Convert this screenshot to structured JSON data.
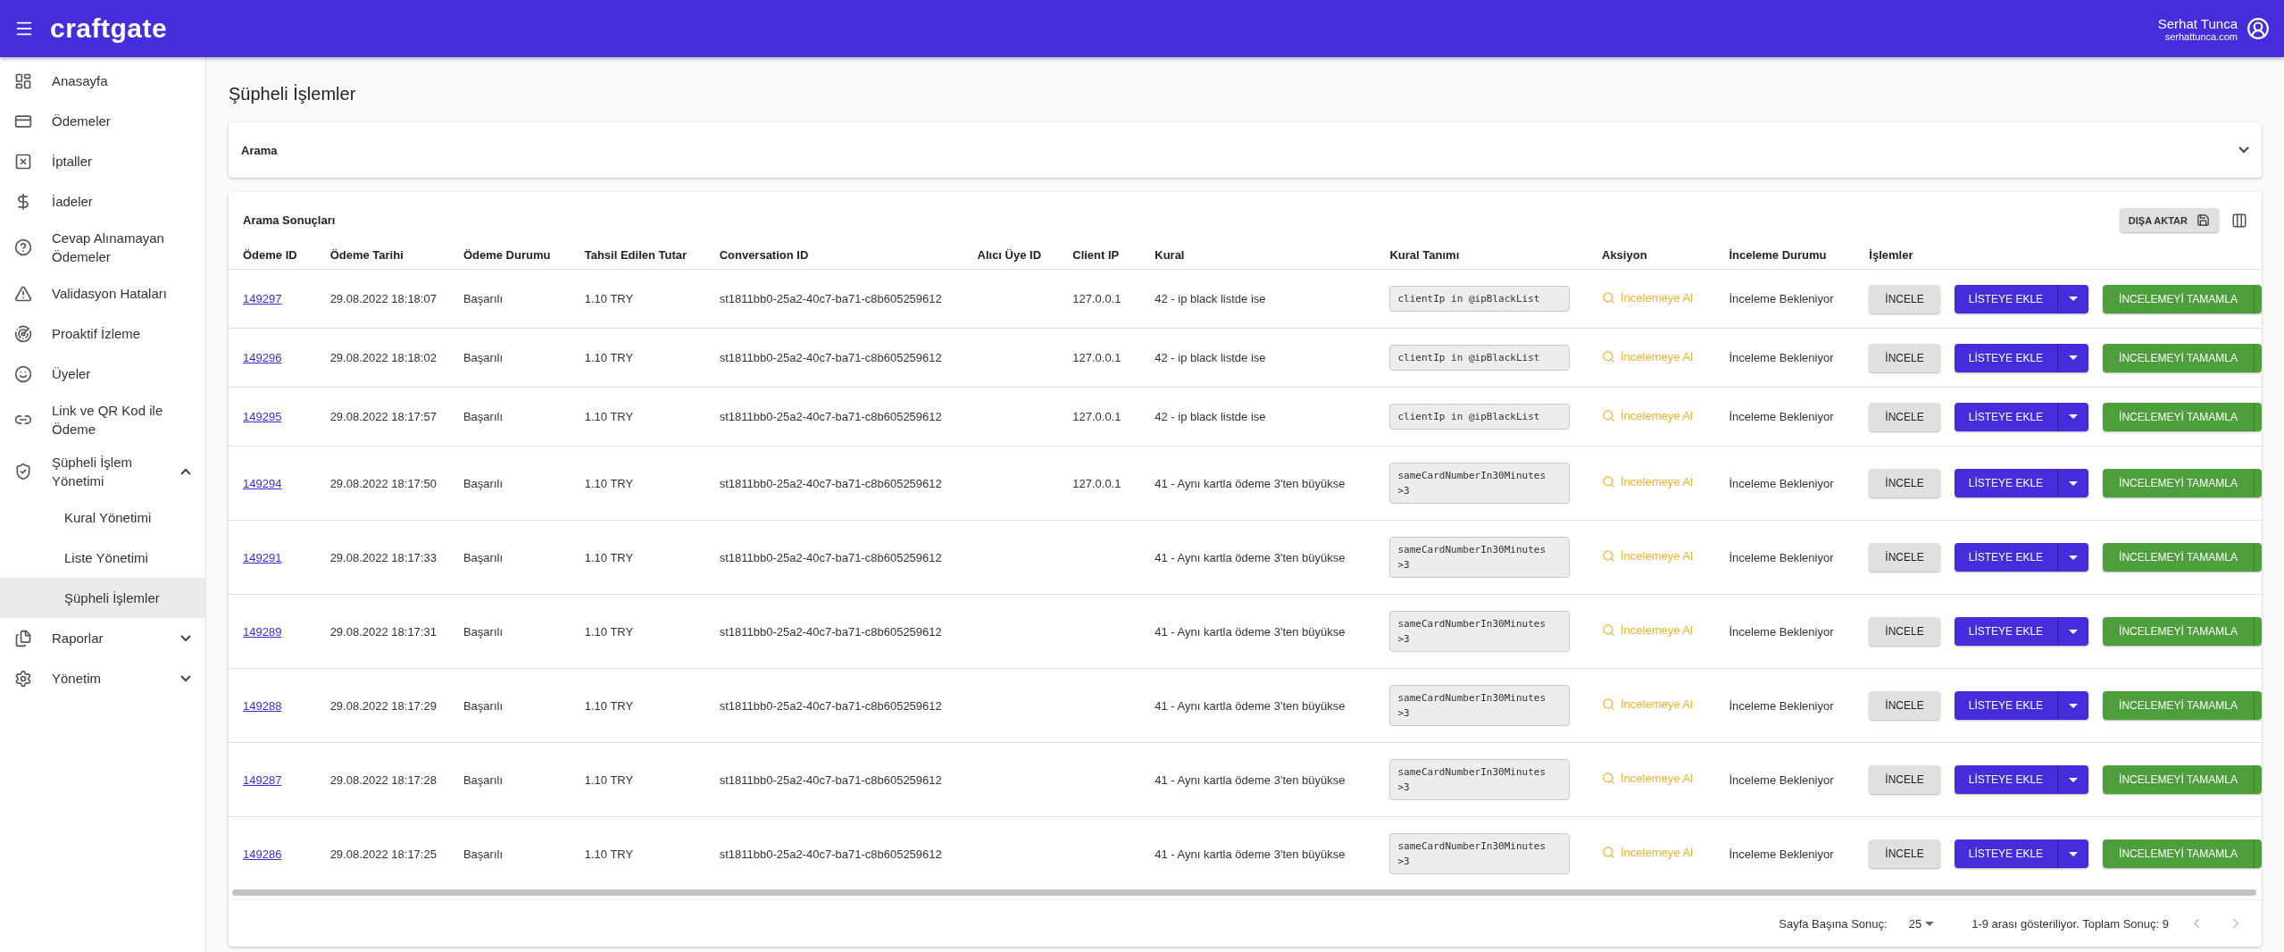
{
  "header": {
    "logo": "craftgate",
    "user_name": "Serhat Tunca",
    "user_site": "serhattunca.com"
  },
  "sidebar": {
    "items": [
      {
        "label": "Anasayfa",
        "selected": false
      },
      {
        "label": "Ödemeler",
        "selected": false
      },
      {
        "label": "İptaller",
        "selected": false
      },
      {
        "label": "İadeler",
        "selected": false
      },
      {
        "label": "Cevap Alınamayan Ödemeler",
        "selected": false
      },
      {
        "label": "Validasyon Hataları",
        "selected": false
      },
      {
        "label": "Proaktif İzleme",
        "selected": false
      },
      {
        "label": "Üyeler",
        "selected": false
      },
      {
        "label": "Link ve QR Kod ile Ödeme",
        "selected": false
      },
      {
        "label": "Şüpheli İşlem Yönetimi",
        "selected": false,
        "expanded": true,
        "children": [
          {
            "label": "Kural Yönetimi",
            "selected": false
          },
          {
            "label": "Liste Yönetimi",
            "selected": false
          },
          {
            "label": "Şüpheli İşlemler",
            "selected": true
          }
        ]
      },
      {
        "label": "Raporlar",
        "selected": false,
        "expanded": false
      },
      {
        "label": "Yönetim",
        "selected": false,
        "expanded": false
      }
    ]
  },
  "page_title": "Şüpheli İşlemler",
  "search_panel": {
    "title": "Arama",
    "expanded": false
  },
  "results": {
    "title": "Arama Sonuçları",
    "export_button": "DIŞA AKTAR",
    "columns": [
      "Ödeme ID",
      "Ödeme Tarihi",
      "Ödeme Durumu",
      "Tahsil Edilen Tutar",
      "Conversation ID",
      "Alıcı Üye ID",
      "Client IP",
      "Kural",
      "Kural Tanımı",
      "Aksiyon",
      "İnceleme Durumu",
      "İşlemler"
    ],
    "rows": [
      {
        "id": "149297",
        "date": "29.08.2022 18:18:07",
        "status": "Başarılı",
        "amount": "1.10 TRY",
        "conversation_id": "st1811bb0-25a2-40c7-ba71-c8b605259612",
        "client_ip": "127.0.0.1",
        "rule": "42 - ip black listde ise",
        "rule_definition": "clientIp in @ipBlackList",
        "action": "İncelemeye Al",
        "review_status": "İnceleme Bekleniyor",
        "inspect_button": "İNCELE",
        "add_to_list_button": "LİSTEYE EKLE",
        "complete_button": "İNCELEMEYİ TAMAMLA"
      },
      {
        "id": "149296",
        "date": "29.08.2022 18:18:02",
        "status": "Başarılı",
        "amount": "1.10 TRY",
        "conversation_id": "st1811bb0-25a2-40c7-ba71-c8b605259612",
        "client_ip": "127.0.0.1",
        "rule": "42 - ip black listde ise",
        "rule_definition": "clientIp in @ipBlackList",
        "action": "İncelemeye Al",
        "review_status": "İnceleme Bekleniyor",
        "inspect_button": "İNCELE",
        "add_to_list_button": "LİSTEYE EKLE",
        "complete_button": "İNCELEMEYİ TAMAMLA"
      },
      {
        "id": "149295",
        "date": "29.08.2022 18:17:57",
        "status": "Başarılı",
        "amount": "1.10 TRY",
        "conversation_id": "st1811bb0-25a2-40c7-ba71-c8b605259612",
        "client_ip": "127.0.0.1",
        "rule": "42 - ip black listde ise",
        "rule_definition": "clientIp in @ipBlackList",
        "action": "İncelemeye Al",
        "review_status": "İnceleme Bekleniyor",
        "inspect_button": "İNCELE",
        "add_to_list_button": "LİSTEYE EKLE",
        "complete_button": "İNCELEMEYİ TAMAMLA"
      },
      {
        "id": "149294",
        "date": "29.08.2022 18:17:50",
        "status": "Başarılı",
        "amount": "1.10 TRY",
        "conversation_id": "st1811bb0-25a2-40c7-ba71-c8b605259612",
        "client_ip": "127.0.0.1",
        "rule": "41 - Aynı kartla ödeme 3'ten büyükse",
        "rule_definition": "sameCardNumberIn30Minutes >3",
        "action": "İncelemeye Al",
        "review_status": "İnceleme Bekleniyor",
        "inspect_button": "İNCELE",
        "add_to_list_button": "LİSTEYE EKLE",
        "complete_button": "İNCELEMEYİ TAMAMLA"
      },
      {
        "id": "149291",
        "date": "29.08.2022 18:17:33",
        "status": "Başarılı",
        "amount": "1.10 TRY",
        "conversation_id": "st1811bb0-25a2-40c7-ba71-c8b605259612",
        "rule": "41 - Aynı kartla ödeme 3'ten büyükse",
        "rule_definition": "sameCardNumberIn30Minutes >3",
        "action": "İncelemeye Al",
        "review_status": "İnceleme Bekleniyor",
        "inspect_button": "İNCELE",
        "add_to_list_button": "LİSTEYE EKLE",
        "complete_button": "İNCELEMEYİ TAMAMLA"
      },
      {
        "id": "149289",
        "date": "29.08.2022 18:17:31",
        "status": "Başarılı",
        "amount": "1.10 TRY",
        "conversation_id": "st1811bb0-25a2-40c7-ba71-c8b605259612",
        "rule": "41 - Aynı kartla ödeme 3'ten büyükse",
        "rule_definition": "sameCardNumberIn30Minutes >3",
        "action": "İncelemeye Al",
        "review_status": "İnceleme Bekleniyor",
        "inspect_button": "İNCELE",
        "add_to_list_button": "LİSTEYE EKLE",
        "complete_button": "İNCELEMEYİ TAMAMLA"
      },
      {
        "id": "149288",
        "date": "29.08.2022 18:17:29",
        "status": "Başarılı",
        "amount": "1.10 TRY",
        "conversation_id": "st1811bb0-25a2-40c7-ba71-c8b605259612",
        "rule": "41 - Aynı kartla ödeme 3'ten büyükse",
        "rule_definition": "sameCardNumberIn30Minutes >3",
        "action": "İncelemeye Al",
        "review_status": "İnceleme Bekleniyor",
        "inspect_button": "İNCELE",
        "add_to_list_button": "LİSTEYE EKLE",
        "complete_button": "İNCELEMEYİ TAMAMLA"
      },
      {
        "id": "149287",
        "date": "29.08.2022 18:17:28",
        "status": "Başarılı",
        "amount": "1.10 TRY",
        "conversation_id": "st1811bb0-25a2-40c7-ba71-c8b605259612",
        "rule": "41 - Aynı kartla ödeme 3'ten büyükse",
        "rule_definition": "sameCardNumberIn30Minutes >3",
        "action": "İncelemeye Al",
        "review_status": "İnceleme Bekleniyor",
        "inspect_button": "İNCELE",
        "add_to_list_button": "LİSTEYE EKLE",
        "complete_button": "İNCELEMEYİ TAMAMLA"
      },
      {
        "id": "149286",
        "date": "29.08.2022 18:17:25",
        "status": "Başarılı",
        "amount": "1.10 TRY",
        "conversation_id": "st1811bb0-25a2-40c7-ba71-c8b605259612",
        "rule": "41 - Aynı kartla ödeme 3'ten büyükse",
        "rule_definition": "sameCardNumberIn30Minutes >3",
        "action": "İncelemeye Al",
        "review_status": "İnceleme Bekleniyor",
        "inspect_button": "İNCELE",
        "add_to_list_button": "LİSTEYE EKLE",
        "complete_button": "İNCELEMEYİ TAMAMLA"
      }
    ]
  },
  "pagination": {
    "per_page_label": "Sayfa Başına Sonuç:",
    "per_page": "25",
    "summary": "1-9 arası gösteriliyor. Toplam Sonuç: 9"
  }
}
